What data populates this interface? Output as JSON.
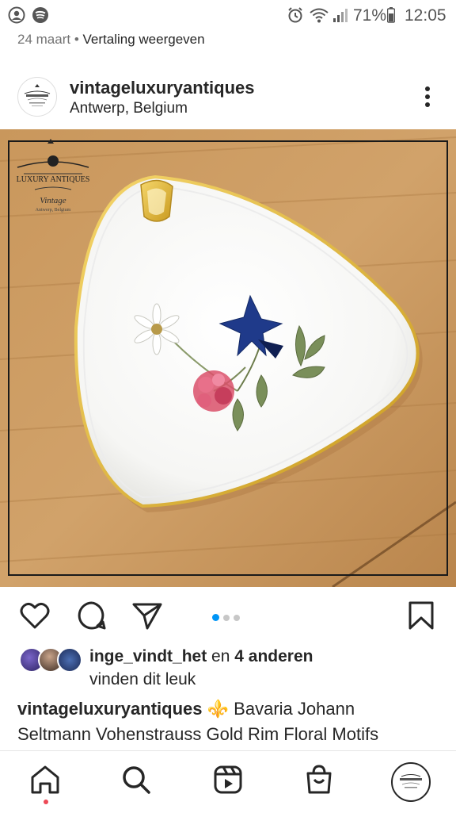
{
  "status_bar": {
    "battery": "71%",
    "time": "12:05"
  },
  "post_meta": {
    "date": "24 maart",
    "separator": "•",
    "translate_link": "Vertaling weergeven"
  },
  "post_header": {
    "username": "vintageluxuryantiques",
    "location": "Antwerp, Belgium"
  },
  "photo": {
    "watermark_brand": "LUXURY ANTIQUES",
    "watermark_script": "Vintage",
    "watermark_city": "Antwerp, Belgium"
  },
  "carousel": {
    "total": 3,
    "active": 0
  },
  "likes": {
    "user": "inge_vindt_het",
    "connector": "en",
    "others": "4 anderen",
    "line2": "vinden dit leuk"
  },
  "caption": {
    "username": "vintageluxuryantiques",
    "emoji": "⚜️",
    "text_line1": "Bavaria Johann",
    "text_line2": "Seltmann Vohenstrauss Gold Rim Floral Motifs"
  },
  "icons": {
    "like": "heart-icon",
    "comment": "comment-icon",
    "share": "send-icon",
    "save": "bookmark-icon",
    "home": "home-icon",
    "search": "search-icon",
    "reels": "reels-icon",
    "shop": "shop-icon",
    "profile": "profile-avatar"
  },
  "colors": {
    "accent_blue": "#0095f6",
    "notification_red": "#ed4956",
    "text": "#262626",
    "muted": "#737373"
  }
}
